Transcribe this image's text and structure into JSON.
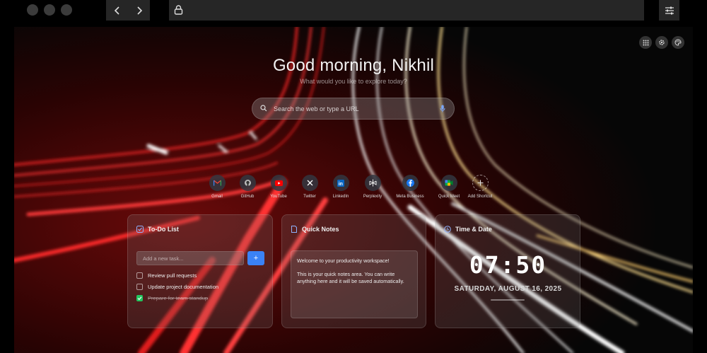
{
  "greeting": "Good morning, Nikhil",
  "subtitle": "What would you like to explore today?",
  "search": {
    "placeholder": "Search the web or type a URL"
  },
  "shortcuts": [
    {
      "label": "Gmail",
      "icon": "gmail-icon"
    },
    {
      "label": "GitHub",
      "icon": "github-icon"
    },
    {
      "label": "YouTube",
      "icon": "youtube-icon"
    },
    {
      "label": "Twitter",
      "icon": "x-icon"
    },
    {
      "label": "LinkedIn",
      "icon": "linkedin-icon"
    },
    {
      "label": "Perplexity",
      "icon": "perplexity-icon"
    },
    {
      "label": "Meta Business",
      "icon": "facebook-icon"
    },
    {
      "label": "Quick Meet",
      "icon": "meet-icon"
    },
    {
      "label": "Add Shortcut",
      "icon": "plus-icon"
    }
  ],
  "todo": {
    "title": "To-Do List",
    "input_placeholder": "Add a new task...",
    "add_label": "+",
    "tasks": [
      {
        "text": "Review pull requests",
        "done": false
      },
      {
        "text": "Update project documentation",
        "done": false
      },
      {
        "text": "Prepare for team standup",
        "done": true
      }
    ]
  },
  "notes": {
    "title": "Quick Notes",
    "p1": "Welcome to your productivity workspace!",
    "p2": "This is your quick notes area. You can write anything here and it will be saved automatically."
  },
  "clock": {
    "title": "Time & Date",
    "time": "07:50",
    "date": "SATURDAY, AUGUST 16, 2025"
  },
  "colors": {
    "accent": "#3b82f6",
    "done": "#22c55e"
  }
}
